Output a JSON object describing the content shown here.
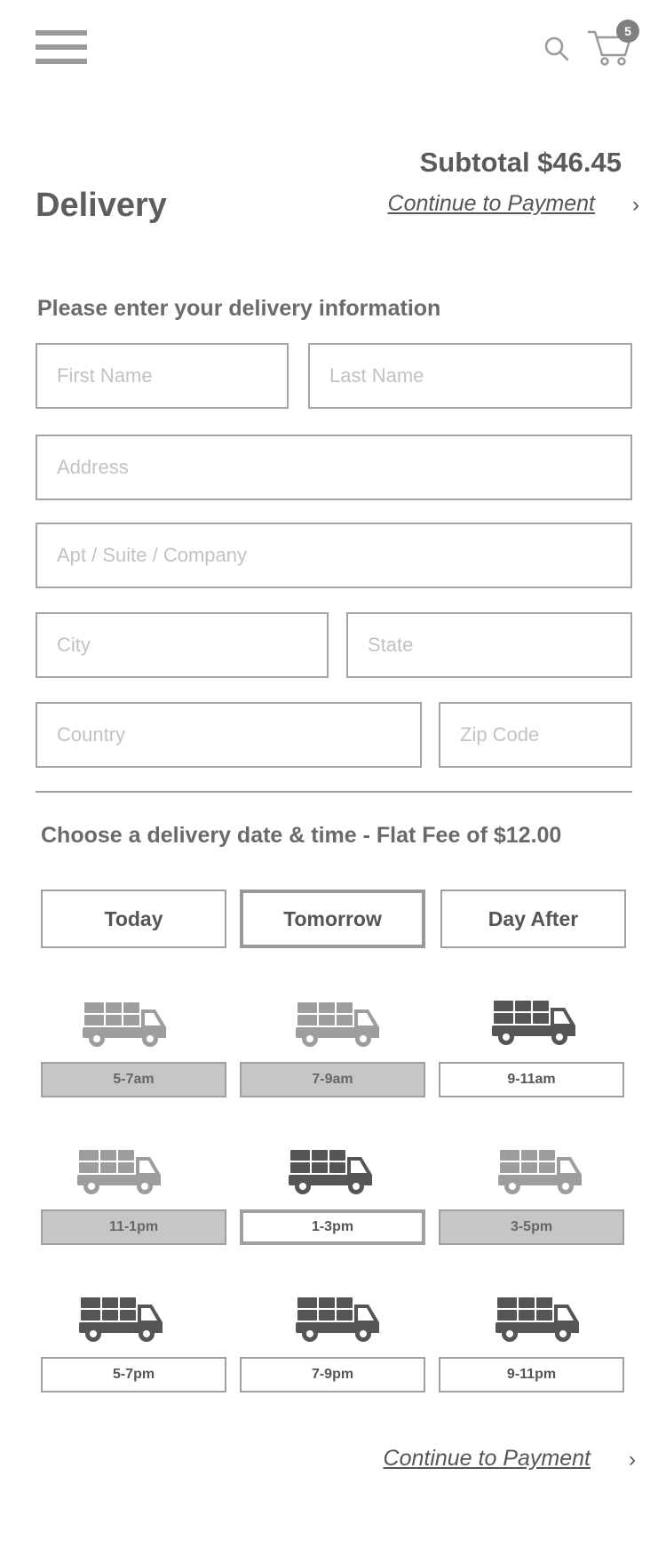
{
  "header": {
    "menu_icon": "hamburger-menu-icon",
    "search_icon": "search-icon",
    "cart_icon": "shopping-cart-icon",
    "cart_count": "5"
  },
  "summary": {
    "subtotal": "Subtotal $46.45",
    "continue_label": "Continue to Payment",
    "chevron": "›"
  },
  "page_title": "Delivery",
  "form": {
    "heading": "Please enter your delivery information",
    "first_name": {
      "placeholder": "First Name",
      "value": ""
    },
    "last_name": {
      "placeholder": "Last Name",
      "value": ""
    },
    "address": {
      "placeholder": "Address",
      "value": ""
    },
    "apt": {
      "placeholder": "Apt / Suite / Company",
      "value": ""
    },
    "city": {
      "placeholder": "City",
      "value": ""
    },
    "state": {
      "placeholder": "State",
      "value": ""
    },
    "country": {
      "placeholder": "Country",
      "value": ""
    },
    "zip": {
      "placeholder": "Zip Code",
      "value": ""
    }
  },
  "delivery": {
    "heading": "Choose a delivery date & time - Flat Fee of $12.00",
    "dates": [
      {
        "label": "Today",
        "selected": false
      },
      {
        "label": "Tomorrow",
        "selected": true
      },
      {
        "label": "Day After",
        "selected": false
      }
    ],
    "slots": [
      {
        "label": "5-7am",
        "available": false,
        "selected": false
      },
      {
        "label": "7-9am",
        "available": false,
        "selected": false
      },
      {
        "label": "9-11am",
        "available": true,
        "selected": false
      },
      {
        "label": "11-1pm",
        "available": false,
        "selected": false
      },
      {
        "label": "1-3pm",
        "available": true,
        "selected": true
      },
      {
        "label": "3-5pm",
        "available": false,
        "selected": false
      },
      {
        "label": "5-7pm",
        "available": true,
        "selected": false
      },
      {
        "label": "7-9pm",
        "available": true,
        "selected": false
      },
      {
        "label": "9-11pm",
        "available": true,
        "selected": false
      }
    ]
  },
  "footer": {
    "continue_label": "Continue to Payment",
    "chevron": "›"
  },
  "colors": {
    "truck_available": "#555555",
    "truck_unavailable": "#9d9d9d",
    "slot_unavailable_bg": "#c6c6c6"
  }
}
